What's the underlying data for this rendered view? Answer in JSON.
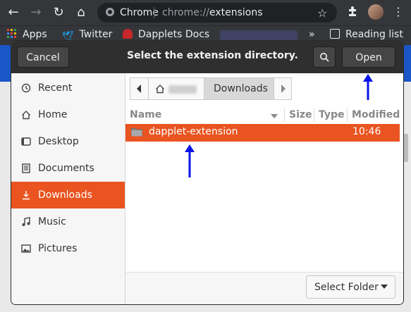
{
  "browser": {
    "tab_site": "Chrome",
    "url_prefix": "chrome://",
    "url_path": "extensions"
  },
  "bookmarks": [
    {
      "label": "Apps",
      "icon": "apps-grid-icon"
    },
    {
      "label": "Twitter",
      "icon": "twitter-bird-icon"
    },
    {
      "label": "Dapplets Docs",
      "icon": "dapplets-icon"
    },
    {
      "label": "Reading list",
      "icon": "reading-list-icon"
    }
  ],
  "dialog": {
    "title": "Select the extension directory.",
    "cancel_label": "Cancel",
    "open_label": "Open",
    "select_folder_label": "Select Folder"
  },
  "places": [
    {
      "label": "Recent",
      "icon": "clock-icon",
      "active": false
    },
    {
      "label": "Home",
      "icon": "home-icon",
      "active": false
    },
    {
      "label": "Desktop",
      "icon": "desktop-icon",
      "active": false
    },
    {
      "label": "Documents",
      "icon": "documents-icon",
      "active": false
    },
    {
      "label": "Downloads",
      "icon": "download-icon",
      "active": true
    },
    {
      "label": "Music",
      "icon": "music-note-icon",
      "active": false
    },
    {
      "label": "Pictures",
      "icon": "picture-icon",
      "active": false
    }
  ],
  "pathbar": {
    "current": "Downloads"
  },
  "columns": {
    "name": "Name",
    "size": "Size",
    "type": "Type",
    "modified": "Modified"
  },
  "files": [
    {
      "name": "dapplet-extension",
      "modified": "10:46",
      "selected": true
    }
  ],
  "colors": {
    "accent": "#e95420",
    "annotation_arrow": "#0a14e6"
  }
}
